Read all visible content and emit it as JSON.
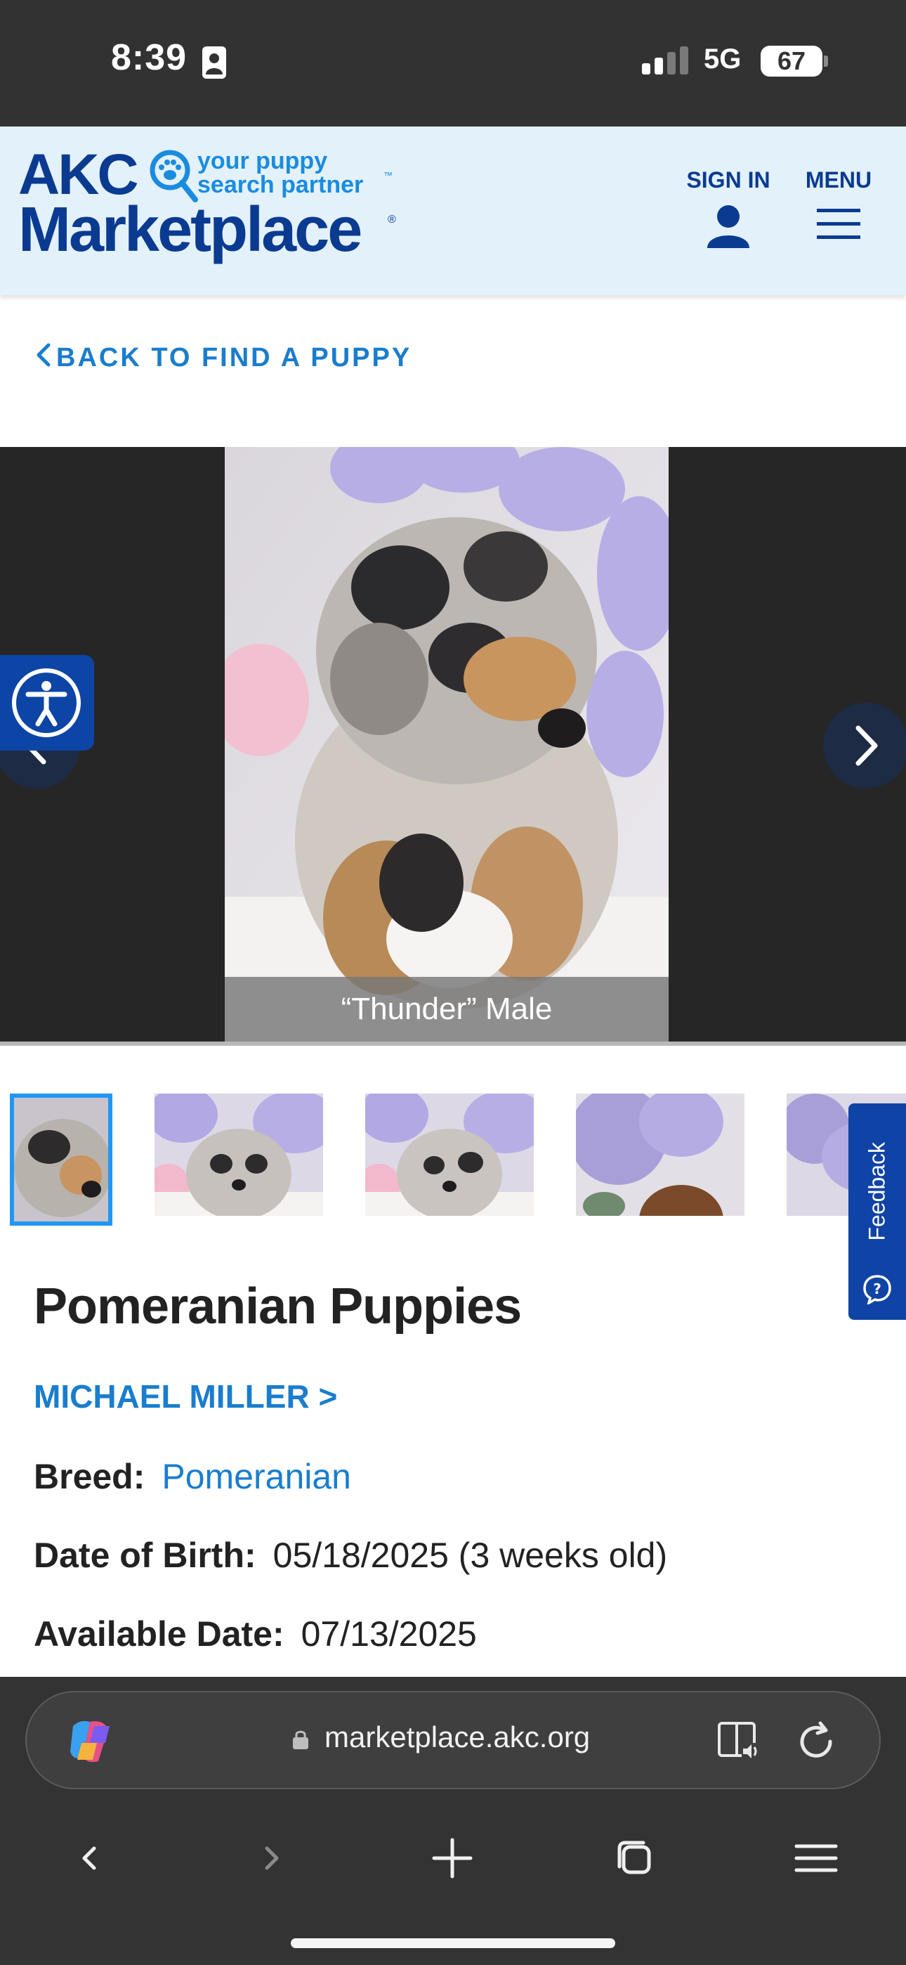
{
  "status_bar": {
    "time": "8:39",
    "network": "5G",
    "battery": "67"
  },
  "header": {
    "logo_main": "AKC",
    "logo_tagline_line1": "your puppy",
    "logo_tagline_line2": "search partner",
    "logo_tm": "™",
    "logo_sub": "Marketplace",
    "logo_reg": "®",
    "sign_in_label": "SIGN IN",
    "menu_label": "MENU"
  },
  "back_link": "BACK TO FIND A PUPPY",
  "gallery": {
    "caption": "“Thunder” Male",
    "thumbnail_count": 5,
    "selected_index": 0
  },
  "feedback_tab": "Feedback",
  "listing": {
    "title": "Pomeranian Puppies",
    "seller": "MICHAEL MILLER >",
    "breed_label": "Breed:",
    "breed_value": "Pomeranian",
    "dob_label": "Date of Birth:",
    "dob_value": "05/18/2025 (3 weeks old)",
    "available_label": "Available Date:",
    "available_value": "07/13/2025"
  },
  "browser": {
    "url": "marketplace.akc.org"
  },
  "colors": {
    "brand_navy": "#0b3b91",
    "link_blue": "#1a7dcd",
    "header_bg": "#e3f1fb",
    "thumb_selected": "#2196f3"
  }
}
